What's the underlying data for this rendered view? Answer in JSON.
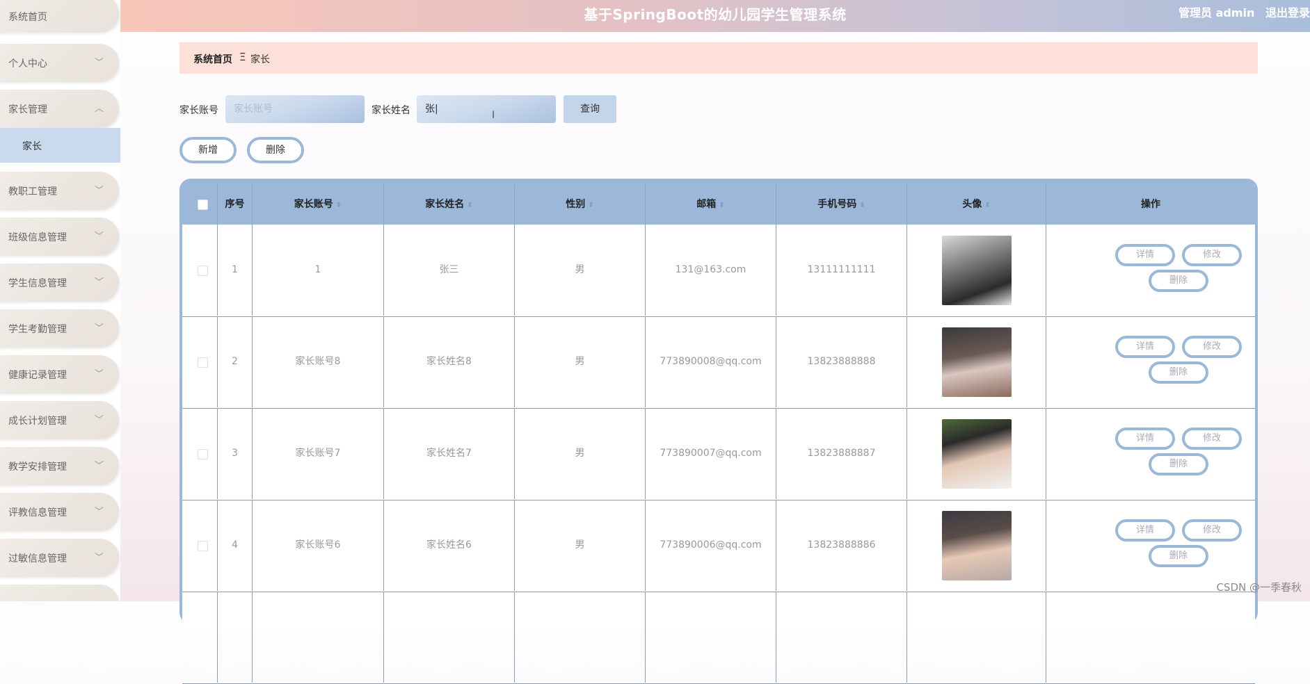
{
  "header": {
    "app_title": "基于SpringBoot的幼儿园学生管理系统",
    "user_label": "管理员 admin",
    "logout_label": "退出登录"
  },
  "sidebar": {
    "items": [
      {
        "label": "系统首页"
      },
      {
        "label": "个人中心"
      },
      {
        "label": "家长管理"
      },
      {
        "label": "教职工管理"
      },
      {
        "label": "班级信息管理"
      },
      {
        "label": "学生信息管理"
      },
      {
        "label": "学生考勤管理"
      },
      {
        "label": "健康记录管理"
      },
      {
        "label": "成长计划管理"
      },
      {
        "label": "教学安排管理"
      },
      {
        "label": "评教信息管理"
      },
      {
        "label": "过敏信息管理"
      }
    ],
    "active_sub_item": "家长"
  },
  "breadcrumb": {
    "home": "系统首页",
    "separator": "Ξ",
    "current": "家长"
  },
  "search": {
    "account_label": "家长账号",
    "account_placeholder": "家长账号",
    "account_value": "",
    "name_label": "家长姓名",
    "name_value": "张",
    "query_label": "查询"
  },
  "actions": {
    "add_label": "新增",
    "delete_label": "删除"
  },
  "table": {
    "columns": [
      "序号",
      "家长账号",
      "家长姓名",
      "性别",
      "邮箱",
      "手机号码",
      "头像",
      "操作"
    ],
    "rows": [
      {
        "index": "1",
        "account": "1",
        "name": "张三",
        "gender": "男",
        "email": "131@163.com",
        "phone": "13111111111"
      },
      {
        "index": "2",
        "account": "家长账号8",
        "name": "家长姓名8",
        "gender": "男",
        "email": "773890008@qq.com",
        "phone": "13823888888"
      },
      {
        "index": "3",
        "account": "家长账号7",
        "name": "家长姓名7",
        "gender": "男",
        "email": "773890007@qq.com",
        "phone": "13823888887"
      },
      {
        "index": "4",
        "account": "家长账号6",
        "name": "家长姓名6",
        "gender": "男",
        "email": "773890006@qq.com",
        "phone": "13823888886"
      }
    ],
    "op_labels": {
      "detail": "详情",
      "edit": "修改",
      "delete": "删除"
    }
  },
  "watermark": "CSDN @一季春秋",
  "colors": {
    "accent": "#9cb8d8",
    "breadcrumb_bg": "#fde0d8",
    "active_sub_bg": "#c9daed"
  }
}
